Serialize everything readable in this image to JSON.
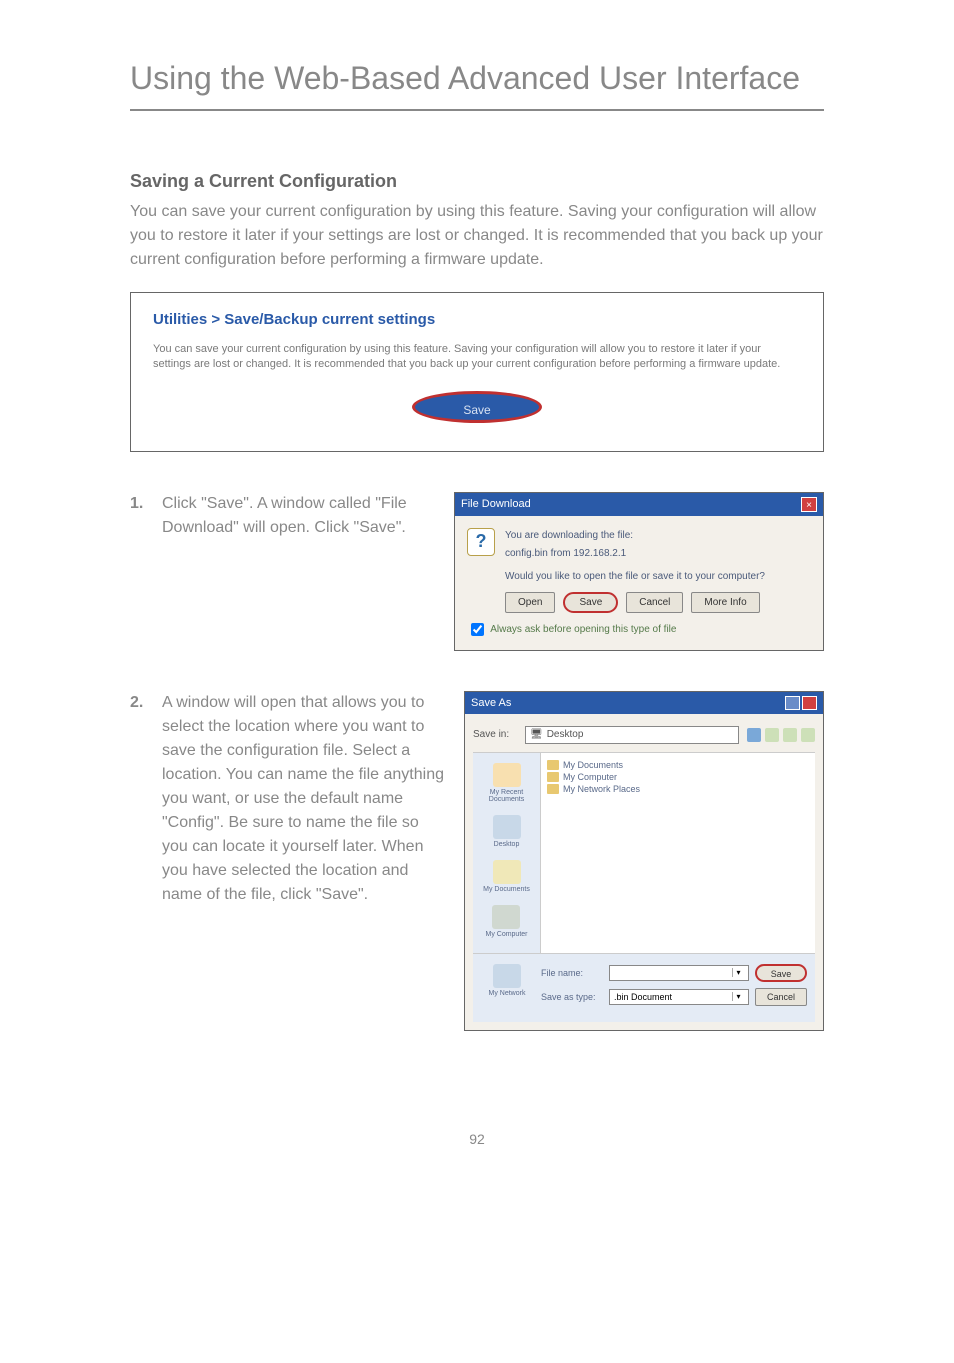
{
  "page_title": "Using the Web-Based Advanced User Interface",
  "section_heading": "Saving a Current Configuration",
  "intro_text": "You can save your current configuration by using this feature. Saving your configuration will allow you to restore it later if your settings are lost or changed. It is recommended that you back up your current configuration before performing a firmware update.",
  "panel": {
    "title": "Utilities > Save/Backup current settings",
    "desc": "You can save your current configuration by using this feature. Saving your configuration will allow you to restore it later if your settings are lost or changed. It is recommended that you back up your current configuration before performing a firmware update.",
    "save_label": "Save"
  },
  "steps": {
    "s1_num": "1.",
    "s1_text": "Click \"Save\". A window called \"File Download\" will open. Click \"Save\".",
    "s2_num": "2.",
    "s2_text": "A window will open that allows you to select the location where you want to save the configuration file. Select a location. You can name the file anything you want, or use the default name \"Config\". Be sure to name the file so you can locate it yourself later. When you have selected the location and name of the file, click \"Save\"."
  },
  "dialog1": {
    "title": "File Download",
    "msg1": "You are downloading the file:",
    "msg2": "config.bin from 192.168.2.1",
    "prompt": "Would you like to open the file or save it to your computer?",
    "btn_open": "Open",
    "btn_save": "Save",
    "btn_cancel": "Cancel",
    "btn_more": "More Info",
    "checkbox": "Always ask before opening this type of file"
  },
  "dialog2": {
    "title": "Save As",
    "savein_label": "Save in:",
    "savein_value": "Desktop",
    "sidebar": {
      "recent": "My Recent Documents",
      "desktop": "Desktop",
      "mydocs": "My Documents",
      "mycomp": "My Computer",
      "mynet": "My Network"
    },
    "files": {
      "f1": "My Documents",
      "f2": "My Computer",
      "f3": "My Network Places"
    },
    "filename_label": "File name:",
    "filename_value": "",
    "savetype_label": "Save as type:",
    "savetype_value": ".bin Document",
    "btn_save": "Save",
    "btn_cancel": "Cancel"
  },
  "page_number": "92"
}
